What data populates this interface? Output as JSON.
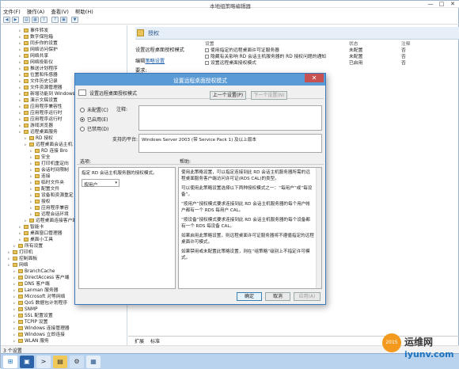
{
  "window": {
    "title": "本地组策略编辑器",
    "min": "—",
    "max": "□",
    "close": "✕"
  },
  "menu": [
    "文件(F)",
    "操作(A)",
    "查看(V)",
    "帮助(H)"
  ],
  "tree": [
    {
      "label": "事件转发",
      "lvl": 3
    },
    {
      "label": "数字保险箱",
      "lvl": 3
    },
    {
      "label": "同步你的设置",
      "lvl": 3
    },
    {
      "label": "网络访问保护",
      "lvl": 3
    },
    {
      "label": "网络共享",
      "lvl": 3
    },
    {
      "label": "网络投影仪",
      "lvl": 3
    },
    {
      "label": "推送计划程序",
      "lvl": 3
    },
    {
      "label": "位置和传感器",
      "lvl": 3
    },
    {
      "label": "文件历史记录",
      "lvl": 3
    },
    {
      "label": "文件资源管理器",
      "lvl": 3
    },
    {
      "label": "新增功能到 Windows",
      "lvl": 3
    },
    {
      "label": "演示文稿设置",
      "lvl": 3
    },
    {
      "label": "应用程序兼容性",
      "lvl": 3
    },
    {
      "label": "应用程序运行时",
      "lvl": 3
    },
    {
      "label": "应用程序运行时",
      "lvl": 3
    },
    {
      "label": "游戏浏览器",
      "lvl": 3
    },
    {
      "label": "远程桌面服务",
      "lvl": 3
    },
    {
      "label": "RD 授权",
      "lvl": 4
    },
    {
      "label": "远程桌面会话主机",
      "lvl": 4
    },
    {
      "label": "RD 连接 Bro",
      "lvl": 5
    },
    {
      "label": "安全",
      "lvl": 5
    },
    {
      "label": "打印机重定向",
      "lvl": 5
    },
    {
      "label": "会话时间限制",
      "lvl": 5
    },
    {
      "label": "连接",
      "lvl": 5
    },
    {
      "label": "临时文件夹",
      "lvl": 5
    },
    {
      "label": "配置文件",
      "lvl": 5
    },
    {
      "label": "设备和资源重定",
      "lvl": 5
    },
    {
      "label": "授权",
      "lvl": 5
    },
    {
      "label": "应用程序兼容",
      "lvl": 5
    },
    {
      "label": "远程会话环境",
      "lvl": 5
    },
    {
      "label": "远程桌面连接客户端",
      "lvl": 4
    },
    {
      "label": "智能卡",
      "lvl": 3
    },
    {
      "label": "桌面窗口管理器",
      "lvl": 3
    },
    {
      "label": "桌面小工具",
      "lvl": 3
    },
    {
      "label": "所有设置",
      "lvl": 2
    },
    {
      "label": "打印机",
      "lvl": 1
    },
    {
      "label": "控制面板",
      "lvl": 1
    },
    {
      "label": "网络",
      "lvl": 1
    },
    {
      "label": "BranchCache",
      "lvl": 2
    },
    {
      "label": "DirectAccess 客户端",
      "lvl": 2
    },
    {
      "label": "DNS 客户端",
      "lvl": 2
    },
    {
      "label": "Lanman 服务器",
      "lvl": 2
    },
    {
      "label": "Microsoft 对等网络",
      "lvl": 2
    },
    {
      "label": "QoS 数据包计划程序",
      "lvl": 2
    },
    {
      "label": "SNMP",
      "lvl": 2
    },
    {
      "label": "SSL 配置设置",
      "lvl": 2
    },
    {
      "label": "TCPIP 设置",
      "lvl": 2
    },
    {
      "label": "Windows 连接管理器",
      "lvl": 2
    },
    {
      "label": "Windows 立即连接",
      "lvl": 2
    },
    {
      "label": "WLAN 服务",
      "lvl": 2
    }
  ],
  "right": {
    "header": "授权",
    "desc_title": "设置远程桌面授权模式",
    "edit_prefix": "编辑",
    "edit_link": "策略设置",
    "req_label": "要求:",
    "columns": [
      "设置",
      "状态",
      "注释"
    ],
    "rows": [
      {
        "name": "使用指定的远程桌面许可证服务器",
        "state": "未配置",
        "note": "否"
      },
      {
        "name": "隐藏有关影响 RD 会话主机服务器的 RD 授权问题的通知",
        "state": "未配置",
        "note": "否"
      },
      {
        "name": "设置远程桌面授权模式",
        "state": "已启用",
        "note": "否"
      }
    ]
  },
  "dialog": {
    "title": "设置远程桌面授权模式",
    "policy_name": "设置远程桌面授权模式",
    "prev_btn": "上一个设置(P)",
    "next_btn": "下一个设置(N)",
    "radio_nc": "未配置(C)",
    "radio_en": "已启用(E)",
    "radio_dis": "已禁用(D)",
    "note_label": "注释:",
    "support_label": "支持的平台:",
    "support_value": "Windows Server 2003 (带 Service Pack 1) 及以上版本",
    "options_label": "选项:",
    "help_label": "帮助:",
    "option_text": "指定 RD 会话主机服务器的授权模式。",
    "select_value": "按用户",
    "help_paras": [
      "使用此策略设置，可以指定连接到此 RD 会话主机服务器所需的远程桌面服务客户端访问许可证(RDS CAL)的类型。",
      "可以使用此策略设置选择以下两种授权模式之一：“每用户”或“每设备”。",
      "“按用户”授权模式要求连接到此 RD 会话主机服务器的每个用户帐户都有一个 RDS 每用户 CAL。",
      "“按设备”授权模式要求连接到此 RD 会话主机服务器的每个设备都有一个 RDS 每设备 CAL。",
      "如果启用此策略设置，则远程桌面许可证服务器将不遵循指定的远程桌面许可模式。",
      "如果禁用或未配置此策略设置，则在“组策略”级别上不指定许可模式。"
    ],
    "ok": "确定",
    "cancel": "取消",
    "apply": "应用(A)"
  },
  "tabs": [
    "扩展",
    "标准"
  ],
  "status": "3 个设置",
  "watermark": {
    "line1": "运维网",
    "line2": "iyunv.com",
    "badge": "2015"
  }
}
